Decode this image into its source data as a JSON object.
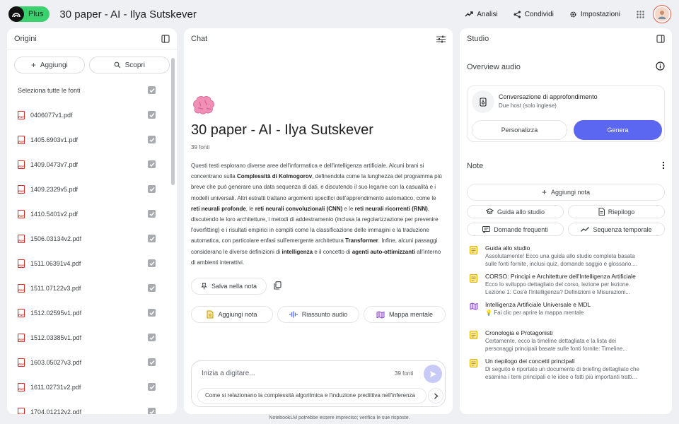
{
  "header": {
    "logo_badge": "Plus",
    "title": "30 paper - AI - Ilya Sutskever",
    "actions": [
      {
        "label": "Analisi",
        "icon": "trending-up-icon"
      },
      {
        "label": "Condividi",
        "icon": "share-icon"
      },
      {
        "label": "Impostazioni",
        "icon": "gear-icon"
      }
    ]
  },
  "sources": {
    "title": "Origini",
    "add_label": "Aggiungi",
    "discover_label": "Scopri",
    "select_all_label": "Seleziona tutte le fonti",
    "items": [
      "0406077v1.pdf",
      "1405.6903v1.pdf",
      "1409.0473v7.pdf",
      "1409.2329v5.pdf",
      "1410.5401v2.pdf",
      "1506.03134v2.pdf",
      "1511.06391v4.pdf",
      "1511.07122v3.pdf",
      "1512.02595v1.pdf",
      "1512.03385v1.pdf",
      "1603.05027v3.pdf",
      "1611.02731v2.pdf",
      "1704.01212v2.pdf"
    ]
  },
  "chat": {
    "title": "Chat",
    "notebook_title": "30 paper - AI - Ilya Sutskever",
    "source_count": "39 fonti",
    "summary": {
      "s1": "Questi testi esplorano diverse aree dell'informatica e dell'intelligenza artificiale. Alcuni brani si concentrano sulla ",
      "b1": "Complessità di Kolmogorov",
      "s2": ", definendola come la lunghezza del programma più breve che può generare una data sequenza di dati, e discutendo il suo legame con la casualità e i modelli universali. Altri estratti trattano argomenti specifici dell'apprendimento automatico, come le ",
      "b2": "reti neurali profonde",
      "s3": ", le ",
      "b3": "reti neurali convoluzionali (CNN)",
      "s4": " e le ",
      "b4": "reti neurali ricorrenti (RNN)",
      "s5": ", discutendo le loro architetture, i metodi di addestramento (inclusa la regolarizzazione per prevenire l'overfitting) e i risultati empirici in compiti come la classificazione delle immagini e la traduzione automatica, con particolare enfasi sull'emergente architettura ",
      "b5": "Transformer",
      "s6": ". Infine, alcuni passaggi considerano le diverse definizioni di ",
      "b6": "intelligenza",
      "s7": " e il concetto di ",
      "b7": "agenti auto-ottimizzanti",
      "s8": " all'interno di ambienti interattivi."
    },
    "save_note_label": "Salva nella nota",
    "chips": [
      "Aggiungi nota",
      "Riassunto audio",
      "Mappa mentale"
    ],
    "composer": {
      "placeholder": "Inizia a digitare...",
      "count": "39 fonti",
      "suggestion": "Come si relazionano la complessità algoritmica e l'induzione predittiva nell'inferenza"
    }
  },
  "studio": {
    "title": "Studio",
    "audio_title": "Overview audio",
    "audio_card": {
      "title": "Conversazione di approfondimento",
      "subtitle": "Due host (solo inglese)",
      "customize_label": "Personalizza",
      "generate_label": "Genera"
    },
    "notes_title": "Note",
    "add_note_label": "Aggiungi nota",
    "note_buttons": [
      {
        "label": "Guida allo studio",
        "icon": "graduation-cap-icon"
      },
      {
        "label": "Riepilogo",
        "icon": "document-icon"
      },
      {
        "label": "Domande frequenti",
        "icon": "faq-icon"
      },
      {
        "label": "Sequenza temporale",
        "icon": "timeline-icon"
      }
    ],
    "notes": [
      {
        "title": "Guida allo studio",
        "preview": "Assolutamente! Ecco una guida allo studio completa basata",
        "preview2": "sulle fonti fornite, inclusi quiz, domande saggio e glossario...."
      },
      {
        "title": "CORSO: Principi e Architetture dell'Intelligenza Artificiale",
        "preview": "Ecco lo sviluppo dettagliato del corso, lezione per lezione.",
        "preview2": "Lezione 1: Cos'è l'Intelligenza? Definizioni e Misurazioni..."
      },
      {
        "title": "Intelligenza Artificiale Universale e MDL",
        "preview": "Fai clic per aprire la mappa mentale",
        "preview2": ""
      },
      {
        "title": "Cronologia e Protagonisti",
        "preview": "Certamente, ecco la timeline dettagliata e la lista dei",
        "preview2": "personaggi principali basate sulle fonti fornite: Timeline..."
      },
      {
        "title": "Un riepilogo dei concetti principali",
        "preview": "Di seguito è riportato un documento di briefing dettagliato che",
        "preview2": "esamina i temi principali e le idee o fatti più importanti tratti..."
      }
    ]
  },
  "footer": "NotebookLM potrebbe essere impreciso; verifica le sue risposte."
}
